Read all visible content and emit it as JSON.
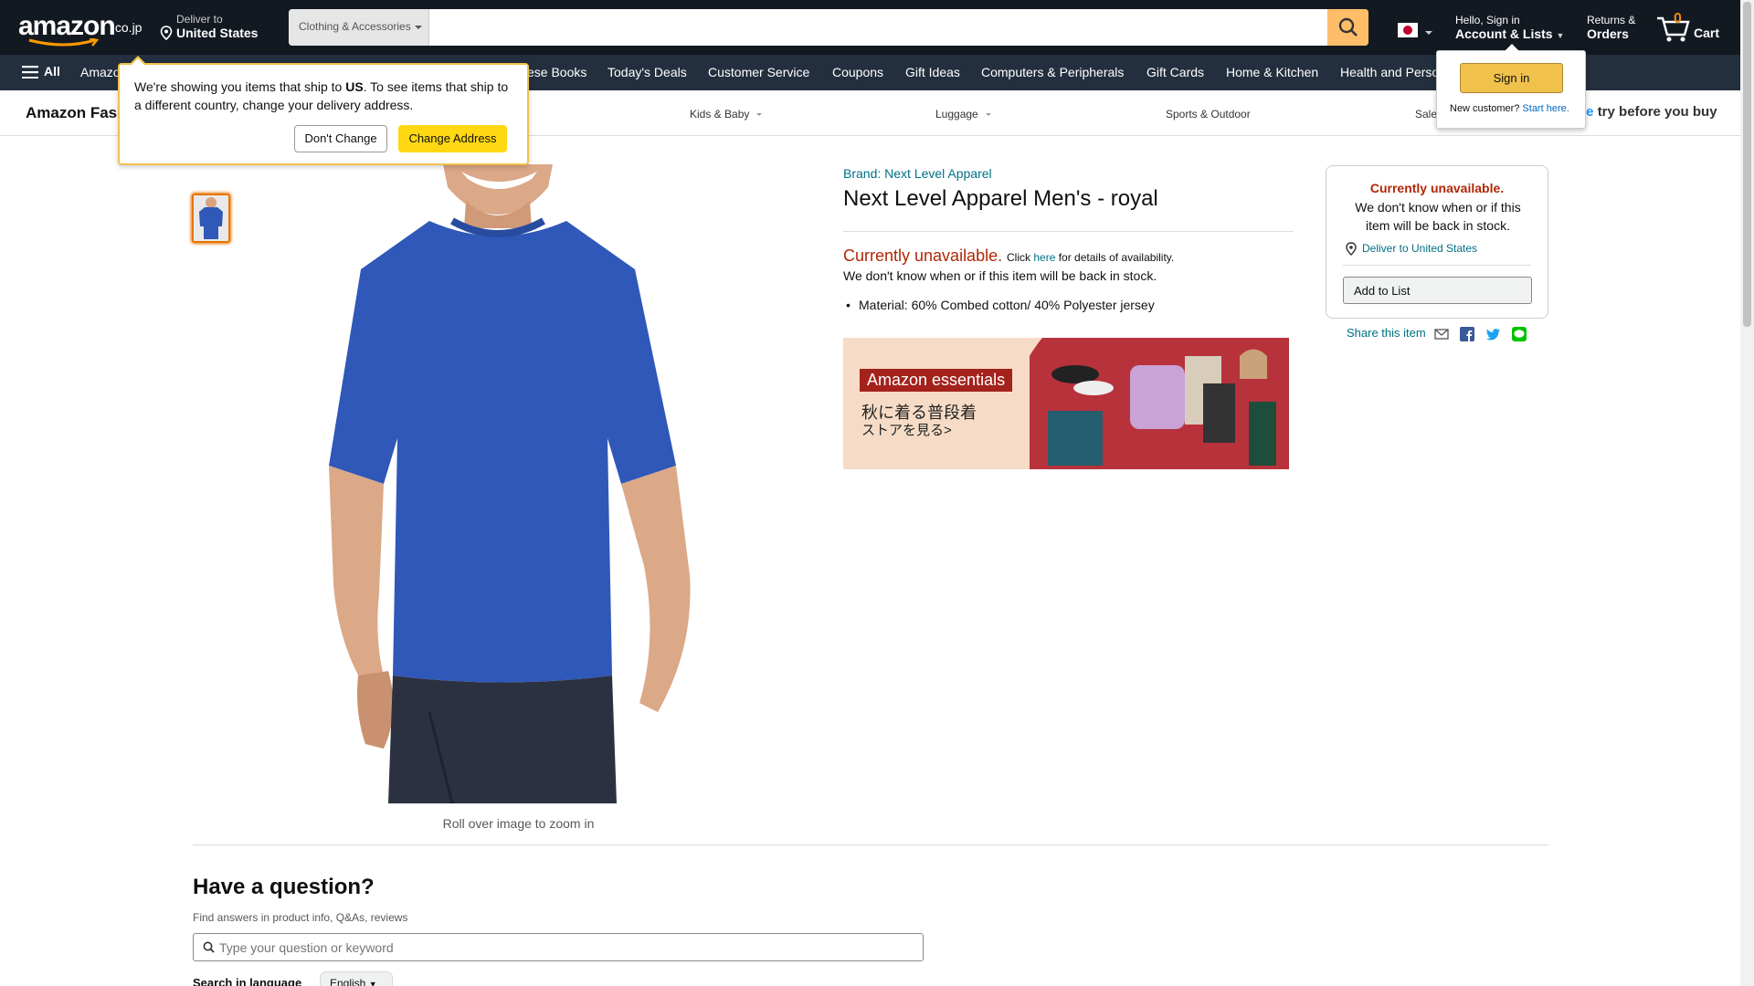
{
  "header": {
    "logo_text": "amazon",
    "logo_tld": ".co.jp",
    "deliver_line1": "Deliver to",
    "deliver_line2": "United States",
    "search_dept": "Clothing & Accessories",
    "search_placeholder": "",
    "account_line1": "Hello, Sign in",
    "account_line2": "Account & Lists",
    "returns_line1": "Returns &",
    "returns_line2": "Orders",
    "cart_count": "0",
    "cart_label": "Cart"
  },
  "subnav": {
    "all_label": "All",
    "items": [
      "Amazon",
      "ese Books",
      "Today's Deals",
      "Customer Service",
      "Coupons",
      "Gift Ideas",
      "Computers & Peripherals",
      "Gift Cards",
      "Home & Kitchen",
      "Health and Perso"
    ]
  },
  "fashion_nav": {
    "brand": "Amazon Fas",
    "categories": [
      "Kids & Baby",
      "Luggage",
      "Sports & Outdoor",
      "Sale"
    ],
    "try_before": "try before you buy"
  },
  "popover": {
    "text_before": "We're showing you items that ship to ",
    "country": "US",
    "text_after": ". To see items that ship to a different country, change your delivery address.",
    "dont_change": "Don't Change",
    "change_address": "Change Address"
  },
  "signin": {
    "button": "Sign in",
    "new_customer": "New customer?",
    "start_here": "Start here."
  },
  "product": {
    "zoom_hint": "Roll over image to zoom in",
    "brand": "Brand: Next Level Apparel",
    "title": "Next Level Apparel Men's - royal",
    "unavailable": "Currently unavailable.",
    "click_text": "Click",
    "here": "here",
    "details_text": "for details of availability.",
    "unavailable_sub": "We don't know when or if this item will be back in stock.",
    "bullet": "Material: 60% Combed cotton/ 40% Polyester jersey",
    "banner_pill": "Amazon essentials",
    "banner_jp1": "秋に着る普段着",
    "banner_jp2": "ストアを見る>"
  },
  "buybox": {
    "unavailable": "Currently unavailable.",
    "sub": "We don't know when or if this item will be back in stock.",
    "deliver": "Deliver to United States",
    "add_to_list": "Add to List",
    "share": "Share this item"
  },
  "qa": {
    "title": "Have a question?",
    "sub": "Find answers in product info, Q&As, reviews",
    "placeholder": "Type your question or keyword",
    "lang_label": "Search in language",
    "lang_value": "English"
  },
  "colors": {
    "nav_dark": "#131921",
    "nav_sub": "#232f3e",
    "search_btn": "#febd69",
    "link": "#007185",
    "price_red": "#b12704",
    "yellow_button": "#ffd814",
    "shirt_blue": "#2f58b8"
  }
}
